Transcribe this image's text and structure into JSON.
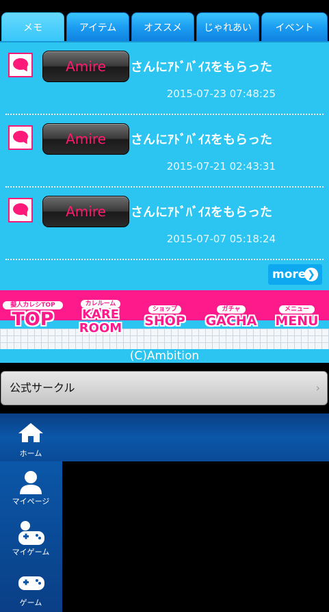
{
  "tabs": [
    {
      "label": "メモ",
      "active": true
    },
    {
      "label": "アイテム",
      "active": false
    },
    {
      "label": "オススメ",
      "active": false
    },
    {
      "label": "じゃれあい",
      "active": false
    },
    {
      "label": "イベント",
      "active": false
    }
  ],
  "memos": [
    {
      "name": "Amire",
      "text": "さんにｱﾄﾞﾊﾞｲｽをもらった",
      "date": "2015-07-23 07:48:25"
    },
    {
      "name": "Amire",
      "text": "さんにｱﾄﾞﾊﾞｲｽをもらった",
      "date": "2015-07-21 02:43:31"
    },
    {
      "name": "Amire",
      "text": "さんにｱﾄﾞﾊﾞｲｽをもらった",
      "date": "2015-07-07 05:18:24"
    }
  ],
  "more_label": "more",
  "nav": {
    "top": {
      "sub": "擬人カレシTOP",
      "main": "TOP"
    },
    "kare_room": {
      "sub": "カレルーム",
      "main1": "KARE",
      "main2": "ROOM"
    },
    "shop": {
      "sub": "ショップ",
      "main": "SHOP"
    },
    "gacha": {
      "sub": "ガチャ",
      "main": "GACHA"
    },
    "menu": {
      "sub": "メニュー",
      "main": "MENU"
    }
  },
  "copyright": "(C)Ambition",
  "circle": {
    "label": "公式サークル",
    "chevron": "›"
  },
  "menu": [
    {
      "label": "ホーム",
      "icon": "home-icon"
    },
    {
      "label": "マイページ",
      "icon": "person-icon"
    },
    {
      "label": "マイゲーム",
      "icon": "my-game-icon"
    },
    {
      "label": "ゲーム",
      "icon": "gamepad-icon"
    }
  ],
  "colors": {
    "panel": "#2cc4f1",
    "accent_pink": "#ff1a8c",
    "menu_blue": "#0b57a8"
  }
}
